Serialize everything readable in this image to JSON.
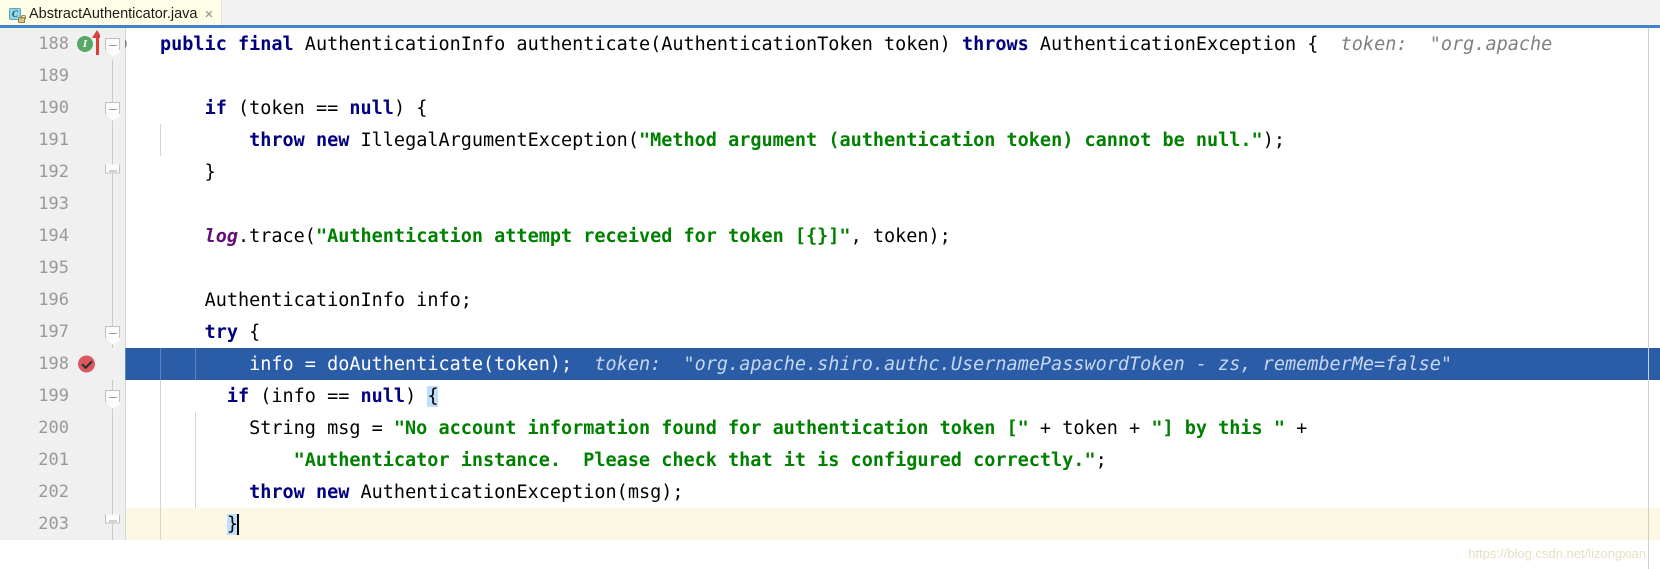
{
  "window": {
    "app": "IntelliJ IDEA Editor",
    "watermark": "https://blog.csdn.net/lizongxian"
  },
  "tab": {
    "label": "AbstractAuthenticator.java",
    "close_label": "×",
    "icon": "java-class-icon",
    "icon_letter": "C",
    "accent_color": "#4083c9",
    "tab_bg": "#ffffe8"
  },
  "gutter": {
    "glyphs": {
      "run": "I",
      "annotation": "@"
    }
  },
  "editor": {
    "selected_line_color": "#2a5ca8",
    "current_line_color": "#fdf8e3",
    "string_color": "#008000",
    "keyword_color": "#000080",
    "hint_color": "#808080",
    "lines": [
      {
        "num": "188"
      },
      {
        "num": "189"
      },
      {
        "num": "190"
      },
      {
        "num": "191"
      },
      {
        "num": "192"
      },
      {
        "num": "193"
      },
      {
        "num": "194"
      },
      {
        "num": "195"
      },
      {
        "num": "196"
      },
      {
        "num": "197"
      },
      {
        "num": "198"
      },
      {
        "num": "199"
      },
      {
        "num": "200"
      },
      {
        "num": "201"
      },
      {
        "num": "202"
      },
      {
        "num": "203"
      }
    ],
    "code": {
      "l188": {
        "kw1": "public",
        "kw2": "final",
        "t1": " AuthenticationInfo authenticate(AuthenticationToken token) ",
        "kw3": "throws",
        "t2": " AuthenticationException {",
        "hint": "token:  \"org.apache"
      },
      "l190": {
        "kw1": "if",
        "t1": " (token == ",
        "kw2": "null",
        "t2": ") {"
      },
      "l191": {
        "kw1": "throw",
        "kw2": "new",
        "t1": " IllegalArgumentException(",
        "str": "\"Method argument (authentication token) cannot be null.\"",
        "t2": ");"
      },
      "l192": {
        "t1": "}"
      },
      "l194": {
        "fld": "log",
        "t1": ".trace(",
        "str": "\"Authentication attempt received for token [{}]\"",
        "t2": ", token);"
      },
      "l196": {
        "t1": "AuthenticationInfo info;"
      },
      "l197": {
        "kw1": "try",
        "t1": " {"
      },
      "l198": {
        "t1": "info = doAuthenticate(token);",
        "hint": "token:  \"org.apache.shiro.authc.UsernamePasswordToken - zs, rememberMe=false\""
      },
      "l199": {
        "kw1": "if",
        "t1": " (info == ",
        "kw2": "null",
        "t2": ") ",
        "brace": "{"
      },
      "l200": {
        "t1": "String msg = ",
        "str": "\"No account information found for authentication token [\"",
        "t2": " + token + ",
        "str2": "\"] by this \"",
        "t3": " +"
      },
      "l201": {
        "str": "\"Authenticator instance.  Please check that it is configured correctly.\"",
        "t1": ";"
      },
      "l202": {
        "kw1": "throw",
        "kw2": "new",
        "t1": " AuthenticationException(msg);"
      },
      "l203": {
        "t1": "}"
      }
    }
  }
}
